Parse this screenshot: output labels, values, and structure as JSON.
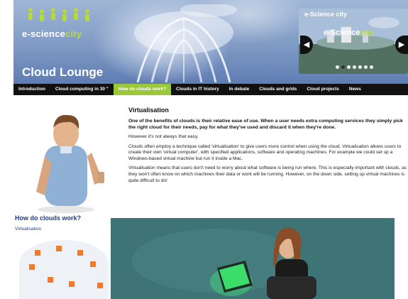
{
  "header": {
    "logo_text_main": "e-science",
    "logo_text_city": "city",
    "section_title": "Cloud Lounge"
  },
  "carousel": {
    "title": "e-Science city",
    "image_text_main": "e-Science",
    "image_text_city": "city",
    "prev_label": "◀",
    "next_label": "▶",
    "dots_count": 7,
    "active_dot": 1
  },
  "nav": {
    "items": [
      {
        "label": "Introduction"
      },
      {
        "label": "Cloud computing in 30 \""
      },
      {
        "label": "How do clouds work?"
      },
      {
        "label": "Clouds in IT history"
      },
      {
        "label": "In debate"
      },
      {
        "label": "Clouds and grids"
      },
      {
        "label": "Cloud projects"
      },
      {
        "label": "News"
      }
    ],
    "active_index": 2
  },
  "sidebar": {
    "title": "How do clouds work?",
    "link": "Virtualisation"
  },
  "content": {
    "heading": "Virtualisation",
    "lead": "One of the benefits of clouds is their relative ease of use. When a user needs extra computing services they simply pick the right cloud for their needs, pay for what they've used and discard it when they're done.",
    "p1": "However it's not always that easy.",
    "p2": "Clouds often employ a technique called 'virtualisation' to give users more control when using the cloud. Virtualisation allows users to create their own 'virtual computer', with specified applications, software and operating machines. For example we could set up a Windows-based virtual machine but run it inside a Mac.",
    "p3": "Virtualisation means that users don't need to worry about what software is being run where. This is especially important with clouds, as they won't often know on which machines their data or work will be running. However, on the down side, setting up virtual machines is quite difficult to do!"
  },
  "colors": {
    "nav_bg": "#111111",
    "nav_active": "#9bc83a",
    "link_blue": "#1e3a8a",
    "accent_green": "#b8d93a",
    "map_orange": "#f07a2a"
  }
}
